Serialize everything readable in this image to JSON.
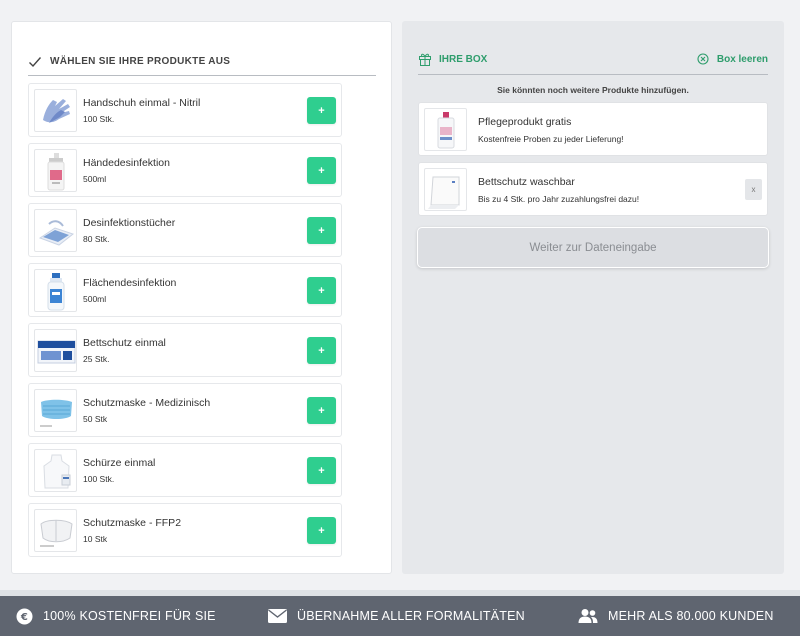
{
  "products_section": {
    "title": "WÄHLEN SIE IHRE PRODUKTE AUS",
    "add_label": "+",
    "items": [
      {
        "name": "Handschuh einmal - Nitril",
        "qty": "100 Stk.",
        "icon": "glove-icon"
      },
      {
        "name": "Händedesinfektion",
        "qty": "500ml",
        "icon": "hand-sanitizer-icon"
      },
      {
        "name": "Desinfektionstücher",
        "qty": "80 Stk.",
        "icon": "wipes-icon"
      },
      {
        "name": "Flächendesinfektion",
        "qty": "500ml",
        "icon": "spray-bottle-icon"
      },
      {
        "name": "Bettschutz einmal",
        "qty": "25 Stk.",
        "icon": "bed-pad-box-icon"
      },
      {
        "name": "Schutzmaske - Medizinisch",
        "qty": "50 Stk",
        "icon": "medical-mask-icon"
      },
      {
        "name": "Schürze einmal",
        "qty": "100 Stk.",
        "icon": "apron-icon"
      },
      {
        "name": "Schutzmaske - FFP2",
        "qty": "10 Stk",
        "icon": "ffp2-mask-icon"
      }
    ]
  },
  "box_section": {
    "title": "IHRE BOX",
    "clear_label": "Box leeren",
    "hint": "Sie könnten noch weitere Produkte hinzufügen.",
    "items": [
      {
        "name": "Pflegeprodukt gratis",
        "desc": "Kostenfreie Proben zu jeder Lieferung!",
        "icon": "care-product-icon"
      },
      {
        "name": "Bettschutz waschbar",
        "desc": "Bis zu 4 Stk. pro Jahr zuzahlungsfrei dazu!",
        "icon": "washable-bed-pad-icon",
        "remove_label": "x"
      }
    ],
    "continue_label": "Weiter zur Dateneingabe"
  },
  "footer": {
    "items": [
      {
        "label": "100% KOSTENFREI FÜR SIE",
        "icon": "euro-icon"
      },
      {
        "label": "ÜBERNAHME ALLER FORMALITÄTEN",
        "icon": "envelope-icon"
      },
      {
        "label": "MEHR ALS 80.000 KUNDEN",
        "icon": "users-icon"
      }
    ]
  },
  "colors": {
    "accent_green": "#2fce8f",
    "heading_green": "#2e9d6c",
    "footer_bg": "#5f6570"
  }
}
